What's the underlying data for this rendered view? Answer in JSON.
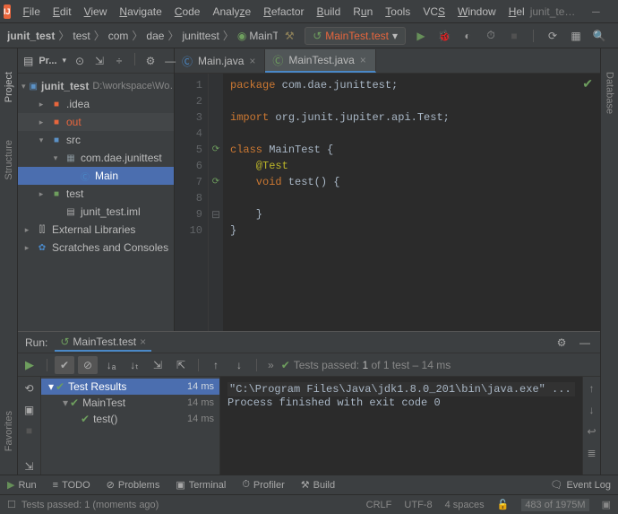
{
  "window": {
    "project_name_right": "junit_te…"
  },
  "menubar": {
    "items": [
      "File",
      "Edit",
      "View",
      "Navigate",
      "Code",
      "Analyze",
      "Refactor",
      "Build",
      "Run",
      "Tools",
      "VCS",
      "Window",
      "Hel"
    ]
  },
  "breadcrumbs": {
    "items": [
      "junit_test",
      "test",
      "com",
      "dae",
      "junittest",
      "MainTest"
    ]
  },
  "run_config": {
    "label": "MainTest.test",
    "dropdown": "▾"
  },
  "project_panel": {
    "title": "Pr...",
    "dropdown": "▾",
    "tree": {
      "root": {
        "label": "junit_test",
        "hint": "D:\\workspace\\Wo…"
      },
      "idea": ".idea",
      "out": "out",
      "src": "src",
      "pkg": "com.dae.junittest",
      "main": "Main",
      "test": "test",
      "iml": "junit_test.iml",
      "ext": "External Libraries",
      "scratches": "Scratches and Consoles"
    }
  },
  "tabs": {
    "main_java": "Main.java",
    "maintest_java": "MainTest.java"
  },
  "code": {
    "line1_kw": "package",
    "line1_rest": " com.dae.junittest;",
    "line3_kw": "import",
    "line3_rest": " org.junit.jupiter.api.Test;",
    "blank": "",
    "line5": "class MainTest {",
    "line5_kw": "class",
    "line5_rest": " MainTest {",
    "line6": "    @Test",
    "line7_kw": "    void",
    "line7_rest": " test() {",
    "line8": "",
    "line9": "    }",
    "line10": "}"
  },
  "run_panel": {
    "title": "Run:",
    "tab": "MainTest.test",
    "tests_passed_prefix": "Tests passed: ",
    "tests_passed_count": "1",
    "tests_passed_rest": " of 1 test – 14 ms",
    "test_results": {
      "root": "Test Results",
      "root_time": "14 ms",
      "class": "MainTest",
      "class_time": "14 ms",
      "method": "test()",
      "method_time": "14 ms"
    },
    "console": {
      "line1": "\"C:\\Program Files\\Java\\jdk1.8.0_201\\bin\\java.exe\" ...",
      "line2": "",
      "line3": "Process finished with exit code 0"
    }
  },
  "bottom_bar": {
    "run": "Run",
    "todo": "TODO",
    "problems": "Problems",
    "terminal": "Terminal",
    "profiler": "Profiler",
    "build": "Build",
    "event_log": "Event Log"
  },
  "status_bar": {
    "left": "Tests passed: 1 (moments ago)",
    "crlf": "CRLF",
    "encoding": "UTF-8",
    "indent": "4 spaces",
    "memory": "483 of 1975M"
  },
  "rails": {
    "project": "Project",
    "structure": "Structure",
    "favorites": "Favorites",
    "database": "Database"
  }
}
